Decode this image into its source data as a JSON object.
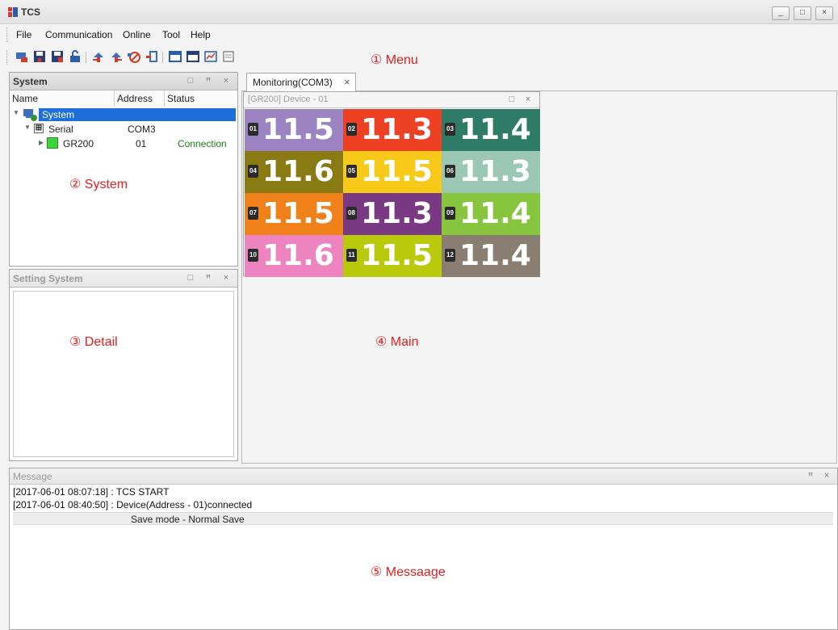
{
  "window": {
    "title": "TCS",
    "minimize": "_",
    "maximize": "□",
    "close": "×"
  },
  "menu": {
    "items": [
      "File",
      "Communication",
      "Online",
      "Tool",
      "Help"
    ]
  },
  "toolbar": {
    "icons": [
      "monitor-icon",
      "save-icon",
      "save-as-icon",
      "lock-icon",
      "connect-icon",
      "disconnect-icon",
      "stop-icon",
      "device-add-icon",
      "window-icon",
      "window-alt-icon",
      "chart-icon",
      "list-icon"
    ]
  },
  "annotations": {
    "menu": "① Menu",
    "system": "② System",
    "detail": "③ Detail",
    "main": "④ Main",
    "message": "⑤ Messaage"
  },
  "system_panel": {
    "title": "System",
    "columns": [
      "Name",
      "Address",
      "Status"
    ],
    "tree": [
      {
        "name": "System",
        "address": "",
        "status": "",
        "level": 0,
        "selected": true
      },
      {
        "name": "Serial",
        "address": "COM3",
        "status": "",
        "level": 1,
        "selected": false
      },
      {
        "name": "GR200",
        "address": "01",
        "status": "Connection",
        "level": 2,
        "selected": false
      }
    ],
    "panel_icons": [
      "□",
      "ꟸ",
      "×"
    ]
  },
  "setting_panel": {
    "title": "Setting System"
  },
  "main": {
    "tab_label": "Monitoring(COM3)",
    "tab_close": "×",
    "device_window_title": "[GR200] Device - 01",
    "tiles": [
      {
        "num": "01",
        "value": "11.5",
        "color": "#9c84c2"
      },
      {
        "num": "02",
        "value": "11.3",
        "color": "#ee4023"
      },
      {
        "num": "03",
        "value": "11.4",
        "color": "#2e7b68"
      },
      {
        "num": "04",
        "value": "11.6",
        "color": "#8a7a14"
      },
      {
        "num": "05",
        "value": "11.5",
        "color": "#f7c919"
      },
      {
        "num": "06",
        "value": "11.3",
        "color": "#9cc7b5"
      },
      {
        "num": "07",
        "value": "11.5",
        "color": "#f08019"
      },
      {
        "num": "08",
        "value": "11.3",
        "color": "#7a3a83"
      },
      {
        "num": "09",
        "value": "11.4",
        "color": "#86c53d"
      },
      {
        "num": "10",
        "value": "11.6",
        "color": "#ee84bf"
      },
      {
        "num": "11",
        "value": "11.5",
        "color": "#b9c90c"
      },
      {
        "num": "12",
        "value": "11.4",
        "color": "#8a7e72"
      }
    ]
  },
  "message_panel": {
    "title": "Message",
    "lines": [
      "[2017-06-01 08:07:18] : TCS START",
      "[2017-06-01 08:40:50] : Device(Address - 01)connected"
    ],
    "status_line": "Save mode - Normal Save"
  },
  "colors": {
    "selection": "#1e6fd9",
    "connection_status": "#1a7a1a",
    "annotation": "#e02020"
  }
}
